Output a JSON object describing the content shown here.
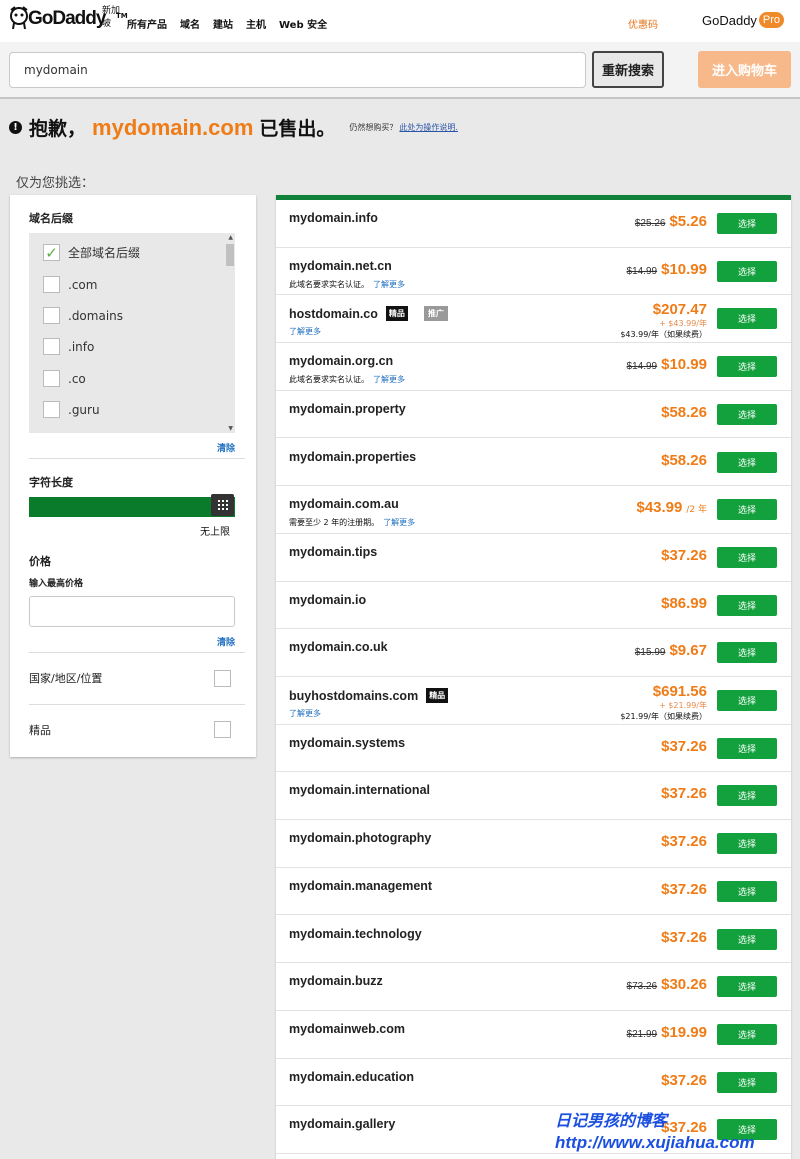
{
  "header": {
    "logo_text": "GoDaddy",
    "logo_tm": "TM",
    "region": "新加坡",
    "nav": [
      "所有产品",
      "域名",
      "建站",
      "主机",
      "Web 安全"
    ],
    "promo": "优惠码",
    "pro_brand": "GoDaddy",
    "pro_badge": "Pro",
    "brand_color": "#ef7c17"
  },
  "search": {
    "value": "mydomain",
    "research_label": "重新搜索",
    "cart_label": "进入购物车"
  },
  "headline": {
    "sorry": "抱歉，",
    "domain": "mydomain.com",
    "sold": "已售出。",
    "still_want": "仍然想购买？",
    "how_link": "此处为操作说明."
  },
  "pick_title": "仅为您挑选：",
  "filters": {
    "tld_title": "域名后缀",
    "tld_options": [
      {
        "label": "全部域名后缀",
        "checked": true
      },
      {
        "label": ".com",
        "checked": false
      },
      {
        "label": ".domains",
        "checked": false
      },
      {
        "label": ".info",
        "checked": false
      },
      {
        "label": ".co",
        "checked": false
      },
      {
        "label": ".guru",
        "checked": false
      }
    ],
    "clear": "清除",
    "length_title": "字符长度",
    "length_value": "无上限",
    "price_title": "价格",
    "price_hint": "输入最高价格",
    "country_title": "国家/地区/位置",
    "premium_title": "精品"
  },
  "results": {
    "select_label": "选择",
    "learn_more": "了解更多",
    "premium_tag": "精品",
    "ad_tag": "推广",
    "rows": [
      {
        "name": "mydomain.info",
        "old": "$25.26",
        "price": "$5.26"
      },
      {
        "name": "mydomain.net.cn",
        "old": "$14.99",
        "price": "$10.99",
        "note": "此域名要求实名认证。"
      },
      {
        "name": "hostdomain.co",
        "price": "$207.47",
        "renew": "+ $43.99/年",
        "renew2": "$43.99/年（如果续费）"
      },
      {
        "name": "mydomain.org.cn",
        "old": "$14.99",
        "price": "$10.99",
        "note": "此域名要求实名认证。"
      },
      {
        "name": "mydomain.property",
        "price": "$58.26"
      },
      {
        "name": "mydomain.properties",
        "price": "$58.26"
      },
      {
        "name": "mydomain.com.au",
        "price": "$43.99",
        "suffix": "/2 年",
        "note": "需要至少 2 年的注册期。"
      },
      {
        "name": "mydomain.tips",
        "price": "$37.26"
      },
      {
        "name": "mydomain.io",
        "price": "$86.99"
      },
      {
        "name": "mydomain.co.uk",
        "old": "$15.99",
        "price": "$9.67"
      },
      {
        "name": "buyhostdomains.com",
        "price": "$691.56",
        "renew": "+ $21.99/年",
        "renew2": "$21.99/年（如果续费）"
      },
      {
        "name": "mydomain.systems",
        "price": "$37.26"
      },
      {
        "name": "mydomain.international",
        "price": "$37.26"
      },
      {
        "name": "mydomain.photography",
        "price": "$37.26"
      },
      {
        "name": "mydomain.management",
        "price": "$37.26"
      },
      {
        "name": "mydomain.technology",
        "price": "$37.26"
      },
      {
        "name": "mydomain.buzz",
        "old": "$73.26",
        "price": "$30.26"
      },
      {
        "name": "mydomainweb.com",
        "old": "$21.99",
        "price": "$19.99"
      },
      {
        "name": "mydomain.education",
        "price": "$37.26"
      },
      {
        "name": "mydomain.gallery",
        "price": "$37.26"
      }
    ]
  },
  "watermark": {
    "line1": "日记男孩的博客",
    "line2": "http://www.xujiahua.com"
  }
}
